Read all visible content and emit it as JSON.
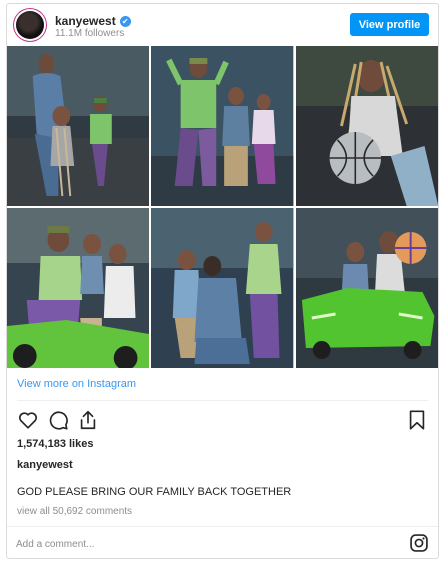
{
  "header": {
    "username": "kanyewest",
    "verified_mark": "✔",
    "followers": "11.1M followers",
    "view_profile_label": "View profile"
  },
  "gallery": {
    "tiles": [
      {
        "name": "photo-mother-with-daughter-and-son"
      },
      {
        "name": "photo-three-kids-cheering"
      },
      {
        "name": "photo-girl-with-basketball"
      },
      {
        "name": "photo-kids-on-toy-atv"
      },
      {
        "name": "photo-mother-kissing-child"
      },
      {
        "name": "photo-kids-in-green-toy-car"
      }
    ]
  },
  "links": {
    "view_more": "View more on Instagram"
  },
  "icons": {
    "like": "heart-icon",
    "comment": "comment-icon",
    "share": "share-icon",
    "save": "bookmark-icon",
    "instagram": "instagram-icon"
  },
  "post": {
    "likes": "1,574,183 likes",
    "author": "kanyewest",
    "caption": "GOD PLEASE BRING OUR FAMILY BACK TOGETHER",
    "comments_link": "view all 50,692 comments"
  },
  "comment_box": {
    "placeholder": "Add a comment..."
  },
  "colors": {
    "accent": "#0095f6",
    "link": "#3897f0",
    "muted": "#8e8e8e",
    "border": "#dbdbdb"
  }
}
